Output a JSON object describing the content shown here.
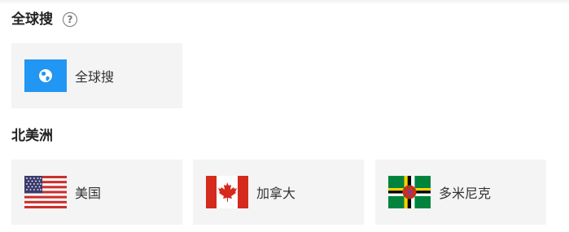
{
  "sections": [
    {
      "title": "全球搜",
      "has_help": true,
      "items": [
        {
          "label": "全球搜",
          "icon": "globe-icon",
          "color": "#2196f3"
        }
      ]
    },
    {
      "title": "北美洲",
      "items": [
        {
          "label": "美国",
          "icon": "us-flag"
        },
        {
          "label": "加拿大",
          "icon": "canada-flag"
        },
        {
          "label": "多米尼克",
          "icon": "dominica-flag"
        }
      ]
    }
  ],
  "help_icon_glyph": "?"
}
